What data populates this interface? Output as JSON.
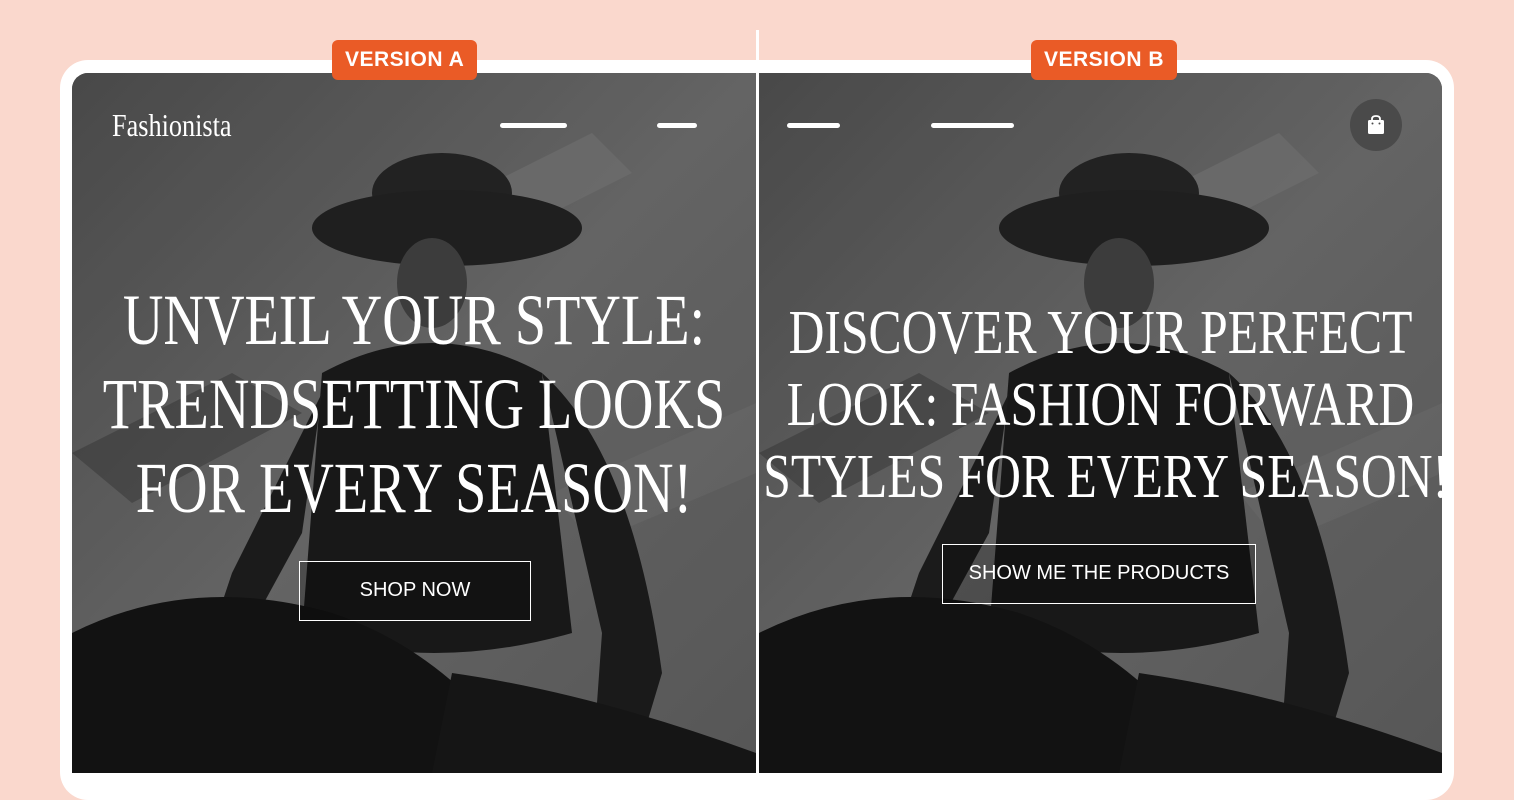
{
  "badges": {
    "a": "VERSION A",
    "b": "VERSION B"
  },
  "version_a": {
    "logo": "Fashionista",
    "headline": [
      "UNVEIL YOUR STYLE:",
      "TRENDSETTING LOOKS",
      "FOR EVERY SEASON!"
    ],
    "cta_label": "SHOP NOW"
  },
  "version_b": {
    "headline": [
      "DISCOVER YOUR PERFECT",
      "LOOK: FASHION FORWARD",
      "STYLES FOR EVERY SEASON!"
    ],
    "cta_label": "SHOW ME THE PRODUCTS",
    "cart_icon": "shopping-bag-icon"
  },
  "colors": {
    "background": "#fad8cd",
    "badge": "#ea5b26",
    "text": "#ffffff"
  }
}
